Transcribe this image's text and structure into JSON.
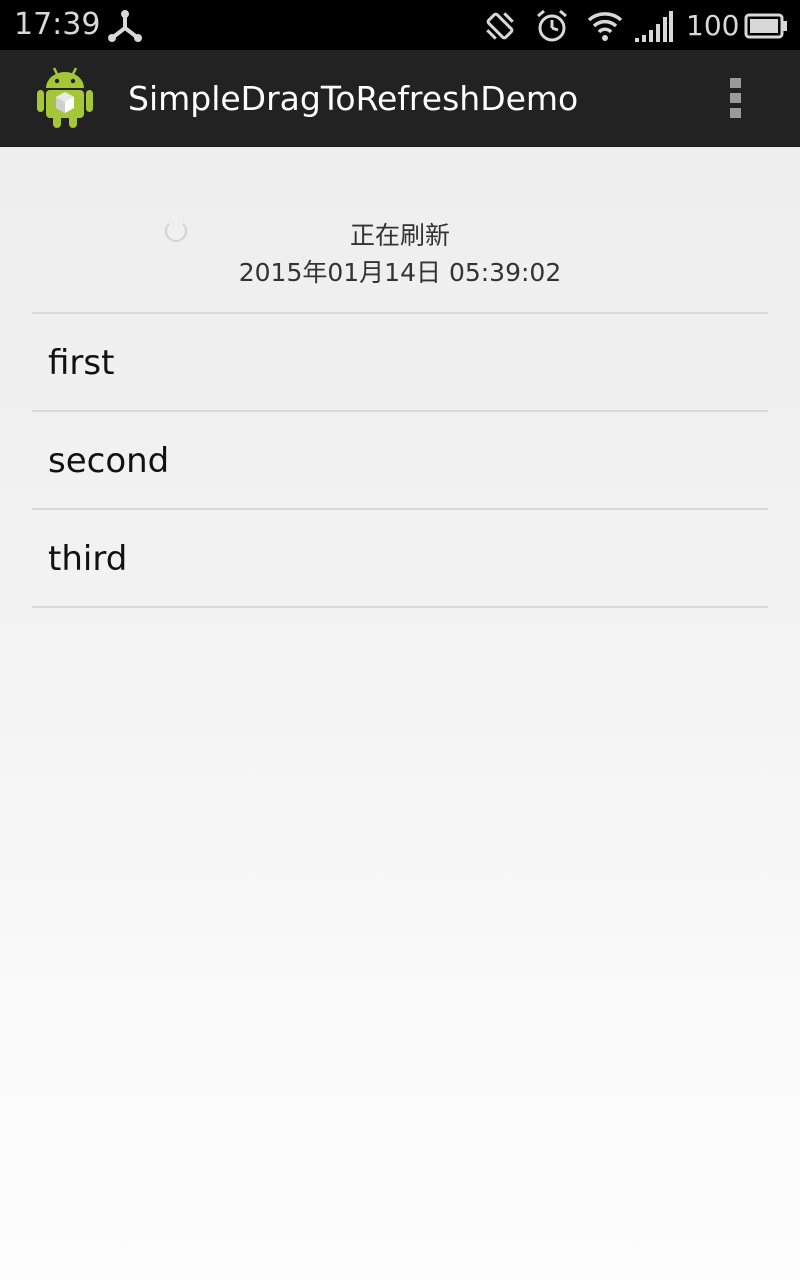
{
  "status_bar": {
    "time": "17:39",
    "battery_percent": "100",
    "icons": [
      "usb-debug-icon",
      "vibrate-icon",
      "alarm-icon",
      "wifi-icon",
      "signal-icon",
      "battery-icon"
    ]
  },
  "action_bar": {
    "title": "SimpleDragToRefreshDemo",
    "app_icon": "android-app-icon",
    "overflow_icon": "overflow-menu-icon"
  },
  "refresh_header": {
    "status_label": "正在刷新",
    "timestamp": "2015年01月14日 05:39:02"
  },
  "list": {
    "items": [
      {
        "label": "first"
      },
      {
        "label": "second"
      },
      {
        "label": "third"
      }
    ]
  },
  "colors": {
    "status_bar_bg": "#000000",
    "action_bar_bg": "#222222",
    "content_bg": "#eeeeee",
    "divider": "#d9d9d9",
    "android_green": "#a4c639"
  }
}
